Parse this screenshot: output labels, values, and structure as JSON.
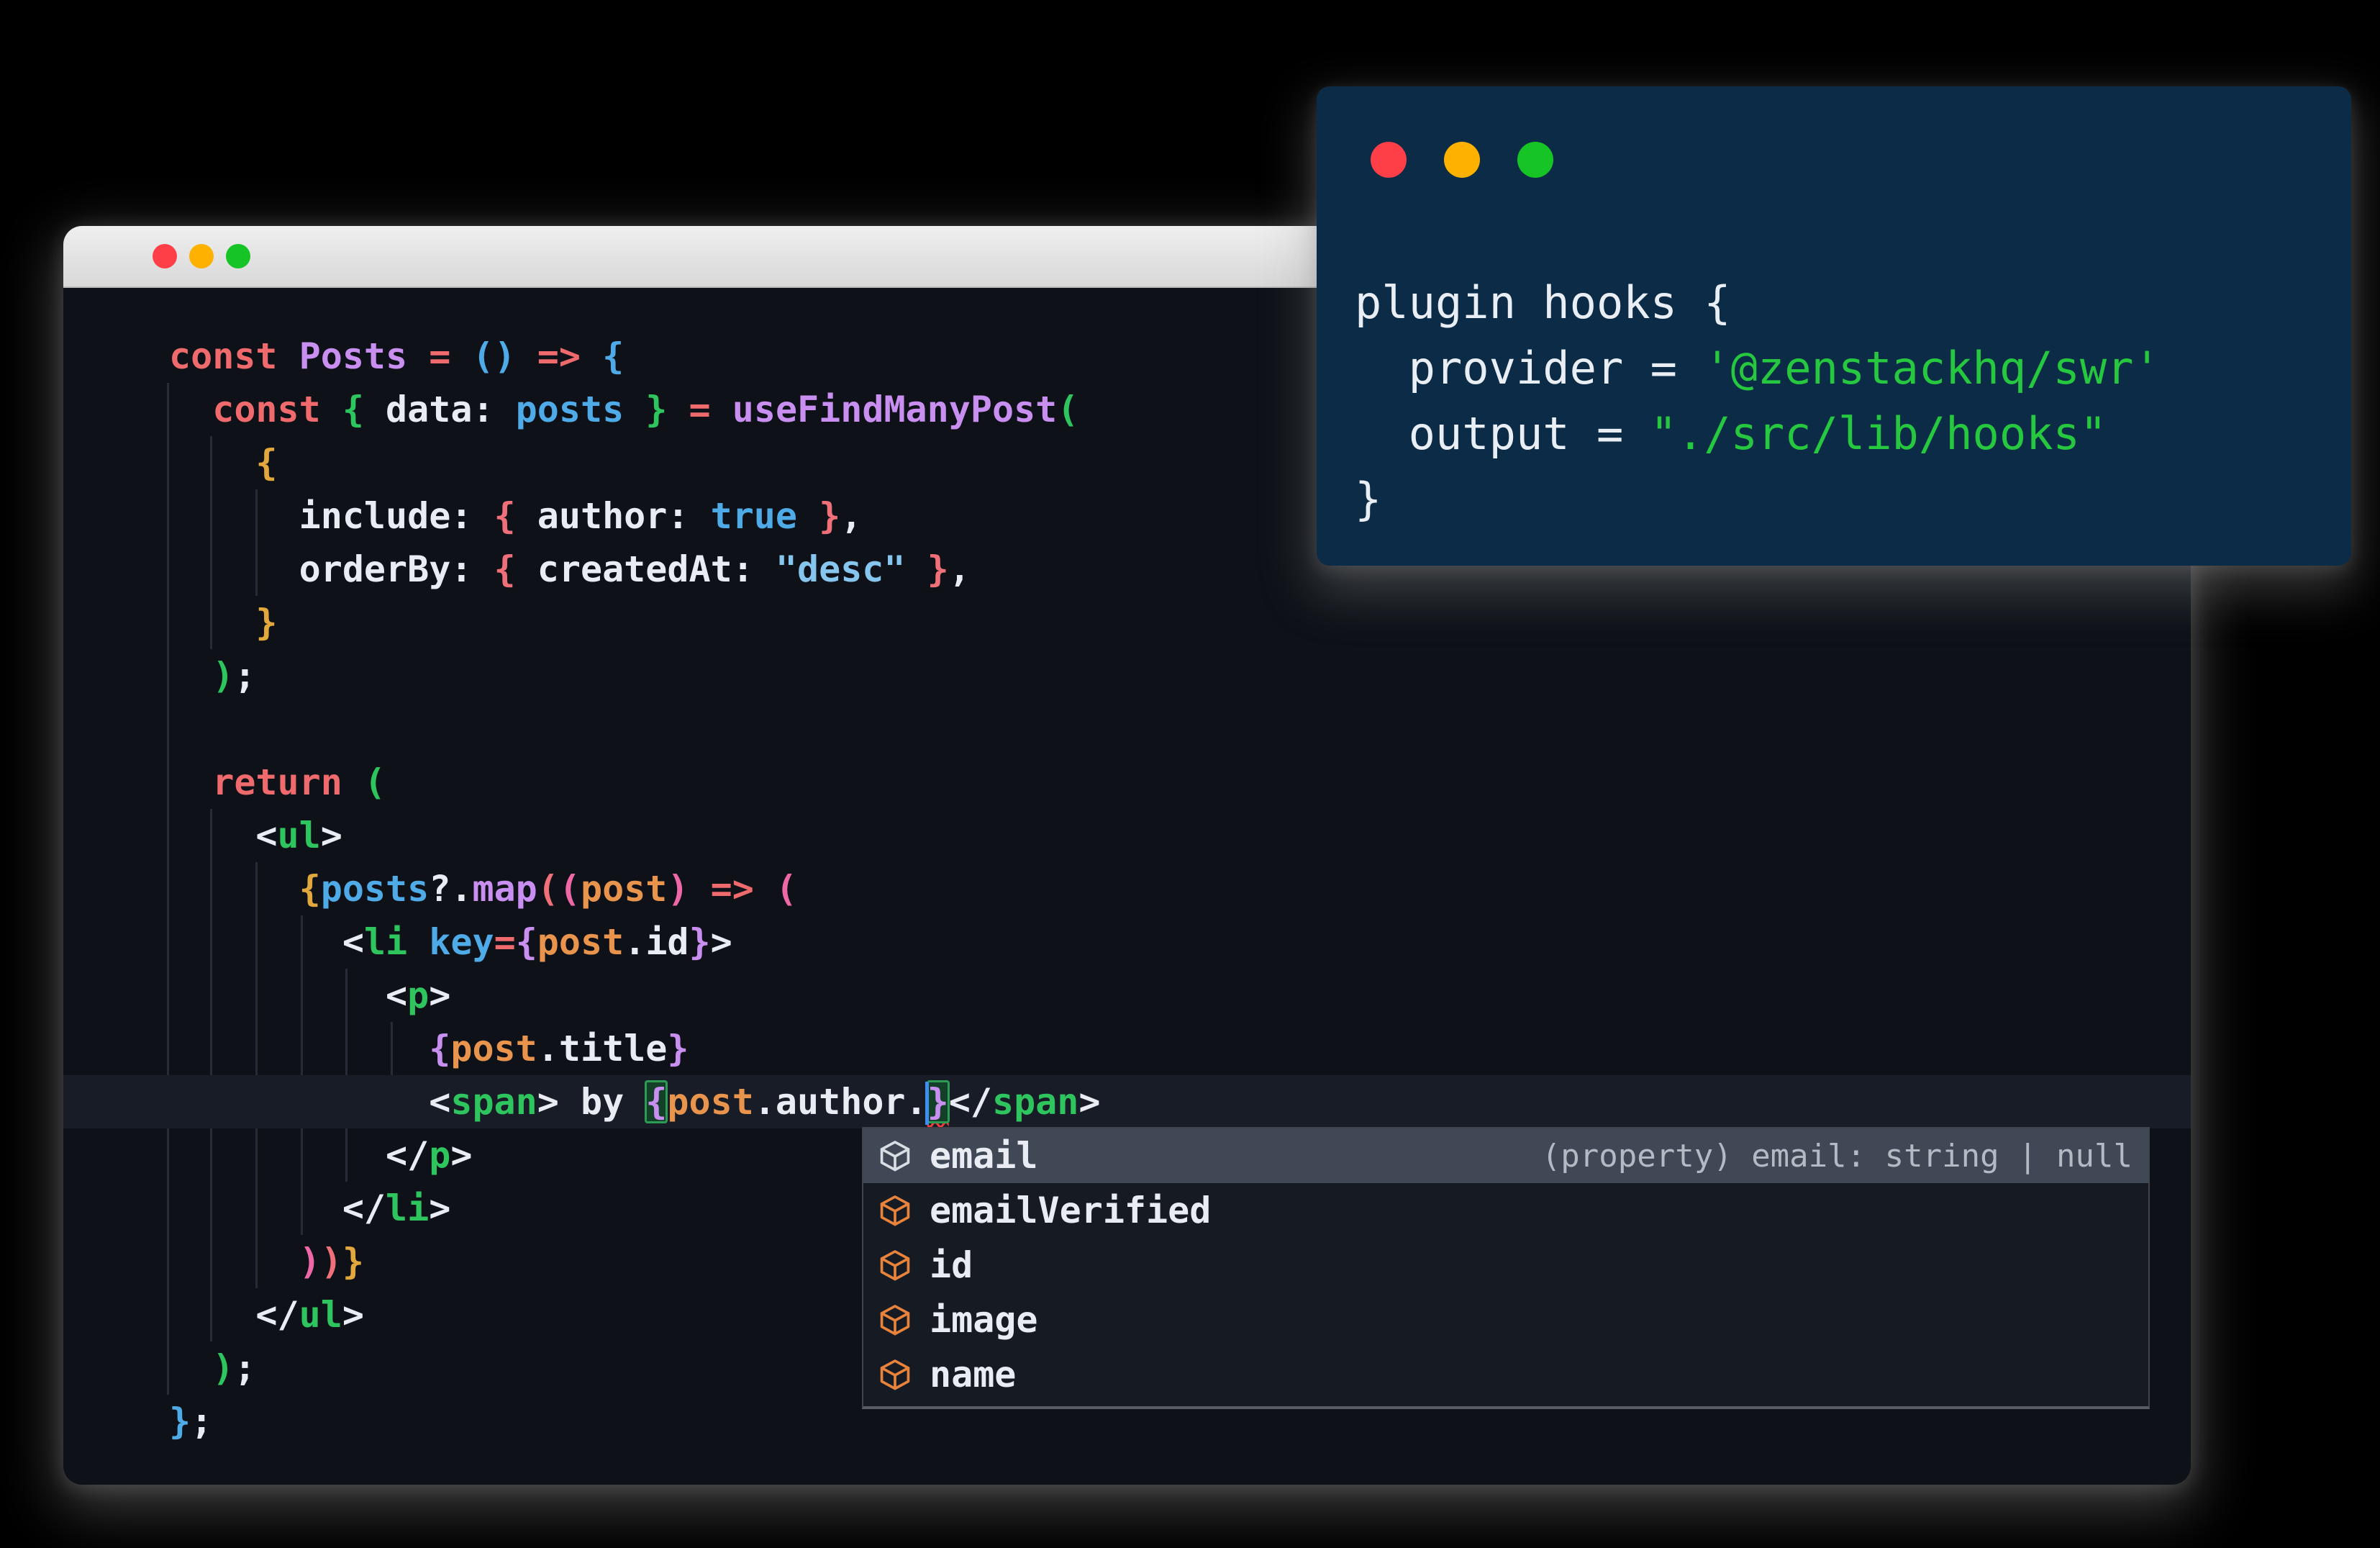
{
  "theme": {
    "editor-bg": "#0e1218",
    "titlebar-top": "#efefef",
    "titlebar-bottom": "#d8d8d8",
    "mac-red": "#ff3f47",
    "mac-yellow": "#ffb100",
    "mac-green": "#17c426",
    "red": "#ef6a6c",
    "purple": "#c88ef0",
    "blue": "#4faae8",
    "str": "#85c5ee",
    "green": "#2fc55e",
    "gold": "#e2a83d",
    "orange": "#e9944d",
    "salmon": "#f0707a",
    "pink": "#ee67a7",
    "white": "#e9edf3",
    "guide": "#252b37",
    "current-line": "#171c26",
    "cursor": "#3e8fee",
    "match-bg": "#14402a",
    "match-border": "#2c9c55",
    "squiggle": "#f43c3c",
    "ac-bg": "#151a23",
    "ac-selected": "#414855",
    "ac-border": "#3e434c",
    "ac-hint": "#b4bac4",
    "ac-icon": "#e8833c",
    "ac-icon-selected": "#d9dee5",
    "schema-bg": "#0c2b46",
    "schema-text": "#e9eef5",
    "schema-string": "#25c83e"
  },
  "main_window": {
    "traffic_lights": [
      "close",
      "minimize",
      "zoom"
    ],
    "code": {
      "current_line": 15,
      "lines": [
        {
          "tokens": [
            [
              "const ",
              "red"
            ],
            [
              "Posts",
              "purple"
            ],
            [
              " ",
              "white"
            ],
            [
              "=",
              "red"
            ],
            [
              " ",
              "white"
            ],
            [
              "()",
              "blue"
            ],
            [
              " ",
              "white"
            ],
            [
              "=>",
              "red"
            ],
            [
              " ",
              "white"
            ],
            [
              "{",
              "blue"
            ]
          ]
        },
        {
          "tokens": [
            [
              "  ",
              "white"
            ],
            [
              "const ",
              "red"
            ],
            [
              "{",
              "green"
            ],
            [
              " data: ",
              "white"
            ],
            [
              "posts",
              "blue"
            ],
            [
              " ",
              "white"
            ],
            [
              "}",
              "green"
            ],
            [
              " ",
              "white"
            ],
            [
              "=",
              "red"
            ],
            [
              " ",
              "white"
            ],
            [
              "useFindManyPost",
              "purple"
            ],
            [
              "(",
              "green"
            ]
          ]
        },
        {
          "tokens": [
            [
              "    ",
              "white"
            ],
            [
              "{",
              "gold"
            ]
          ]
        },
        {
          "tokens": [
            [
              "      include: ",
              "white"
            ],
            [
              "{",
              "salmon"
            ],
            [
              " author: ",
              "white"
            ],
            [
              "true",
              "blue"
            ],
            [
              " ",
              "white"
            ],
            [
              "}",
              "salmon"
            ],
            [
              ",",
              "white"
            ]
          ]
        },
        {
          "tokens": [
            [
              "      orderBy: ",
              "white"
            ],
            [
              "{",
              "salmon"
            ],
            [
              " createdAt: ",
              "white"
            ],
            [
              "\"desc\"",
              "str"
            ],
            [
              " ",
              "white"
            ],
            [
              "}",
              "salmon"
            ],
            [
              ",",
              "white"
            ]
          ]
        },
        {
          "tokens": [
            [
              "    ",
              "white"
            ],
            [
              "}",
              "gold"
            ]
          ]
        },
        {
          "tokens": [
            [
              "  ",
              "white"
            ],
            [
              ")",
              "green"
            ],
            [
              ";",
              "white"
            ]
          ]
        },
        {
          "tokens": []
        },
        {
          "tokens": [
            [
              "  ",
              "white"
            ],
            [
              "return ",
              "red"
            ],
            [
              "(",
              "green"
            ]
          ]
        },
        {
          "tokens": [
            [
              "    <",
              "white"
            ],
            [
              "ul",
              "green"
            ],
            [
              ">",
              "white"
            ]
          ]
        },
        {
          "tokens": [
            [
              "      ",
              "white"
            ],
            [
              "{",
              "gold"
            ],
            [
              "posts",
              "blue"
            ],
            [
              "?.",
              "white"
            ],
            [
              "map",
              "purple"
            ],
            [
              "(",
              "salmon"
            ],
            [
              "(",
              "pink"
            ],
            [
              "post",
              "orange"
            ],
            [
              ")",
              "pink"
            ],
            [
              " ",
              "white"
            ],
            [
              "=>",
              "red"
            ],
            [
              " ",
              "white"
            ],
            [
              "(",
              "pink"
            ]
          ]
        },
        {
          "tokens": [
            [
              "        <",
              "white"
            ],
            [
              "li",
              "green"
            ],
            [
              " ",
              "white"
            ],
            [
              "key",
              "blue"
            ],
            [
              "=",
              "red"
            ],
            [
              "{",
              "purple"
            ],
            [
              "post",
              "orange"
            ],
            [
              ".id",
              "white"
            ],
            [
              "}",
              "purple"
            ],
            [
              ">",
              "white"
            ]
          ]
        },
        {
          "tokens": [
            [
              "          <",
              "white"
            ],
            [
              "p",
              "green"
            ],
            [
              ">",
              "white"
            ]
          ]
        },
        {
          "tokens": [
            [
              "            ",
              "white"
            ],
            [
              "{",
              "purple"
            ],
            [
              "post",
              "orange"
            ],
            [
              ".title",
              "white"
            ],
            [
              "}",
              "purple"
            ]
          ]
        },
        {
          "tokens": [
            [
              "            <",
              "white"
            ],
            [
              "span",
              "green"
            ],
            [
              "> by ",
              "white"
            ],
            [
              "{",
              "purple bm"
            ],
            [
              "post",
              "orange"
            ],
            [
              ".author.",
              "white"
            ],
            [
              "",
              "cursor"
            ],
            [
              "}",
              "purple bm squiggle"
            ],
            [
              "</",
              "white"
            ],
            [
              "span",
              "green"
            ],
            [
              ">",
              "white"
            ]
          ]
        },
        {
          "tokens": [
            [
              "          </",
              "white"
            ],
            [
              "p",
              "green"
            ],
            [
              ">",
              "white"
            ]
          ]
        },
        {
          "tokens": [
            [
              "        </",
              "white"
            ],
            [
              "li",
              "green"
            ],
            [
              ">",
              "white"
            ]
          ]
        },
        {
          "tokens": [
            [
              "      ",
              "white"
            ],
            [
              ")",
              "pink"
            ],
            [
              ")",
              "salmon"
            ],
            [
              "}",
              "gold"
            ]
          ]
        },
        {
          "tokens": [
            [
              "    </",
              "white"
            ],
            [
              "ul",
              "green"
            ],
            [
              ">",
              "white"
            ]
          ]
        },
        {
          "tokens": [
            [
              "  ",
              "white"
            ],
            [
              ")",
              "green"
            ],
            [
              ";",
              "white"
            ]
          ]
        },
        {
          "tokens": [
            [
              "}",
              "blue"
            ],
            [
              ";",
              "white"
            ]
          ]
        }
      ]
    },
    "autocomplete": {
      "items": [
        {
          "label": "email",
          "selected": true,
          "hint": "(property) email: string | null",
          "icon": "field-cube-icon"
        },
        {
          "label": "emailVerified",
          "selected": false,
          "icon": "field-cube-icon"
        },
        {
          "label": "id",
          "selected": false,
          "icon": "field-cube-icon"
        },
        {
          "label": "image",
          "selected": false,
          "icon": "field-cube-icon"
        },
        {
          "label": "name",
          "selected": false,
          "icon": "field-cube-icon"
        }
      ]
    }
  },
  "schema_window": {
    "traffic_lights": [
      "close",
      "minimize",
      "zoom"
    ],
    "lines": [
      {
        "tokens": [
          [
            "plugin hooks {",
            "plain"
          ]
        ]
      },
      {
        "tokens": [
          [
            "  provider = ",
            "plain"
          ],
          [
            "'@zenstackhq/swr'",
            "string"
          ]
        ]
      },
      {
        "tokens": [
          [
            "  output = ",
            "plain"
          ],
          [
            "\"./src/lib/hooks\"",
            "string"
          ]
        ]
      },
      {
        "tokens": [
          [
            "}",
            "plain"
          ]
        ]
      }
    ]
  }
}
